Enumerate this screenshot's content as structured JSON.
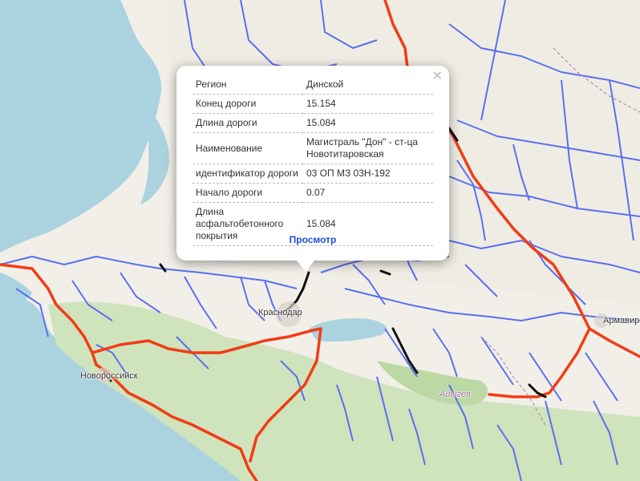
{
  "map": {
    "labels": {
      "krasnodar": "Краснодар",
      "novorossiysk": "Новороссийск",
      "armavir": "Армавир",
      "adygea": "Адыгея"
    },
    "colors": {
      "sea": "#aad3df",
      "land": "#f2efe8",
      "forest": "#cfe3bd",
      "federal_road": "#f23c14",
      "regional_road": "#5b6ff0",
      "selected_road": "#111111"
    }
  },
  "popup": {
    "close_icon": "×",
    "rows": [
      {
        "key": "Регион",
        "value": "Динской"
      },
      {
        "key": "Конец дороги",
        "value": "15.154"
      },
      {
        "key": "Длина дороги",
        "value": "15.084"
      },
      {
        "key": "Наименование",
        "value": "Магистраль \"Дон\" - ст-ца Новотитаровская"
      },
      {
        "key": "идентификатор дороги",
        "value": "03 ОП МЗ 03Н-192"
      },
      {
        "key": "Начало дороги",
        "value": "0.07"
      },
      {
        "key": "Длина асфальтобетонного покрытия",
        "value": "15.084"
      }
    ],
    "view_link": "Просмотр"
  }
}
